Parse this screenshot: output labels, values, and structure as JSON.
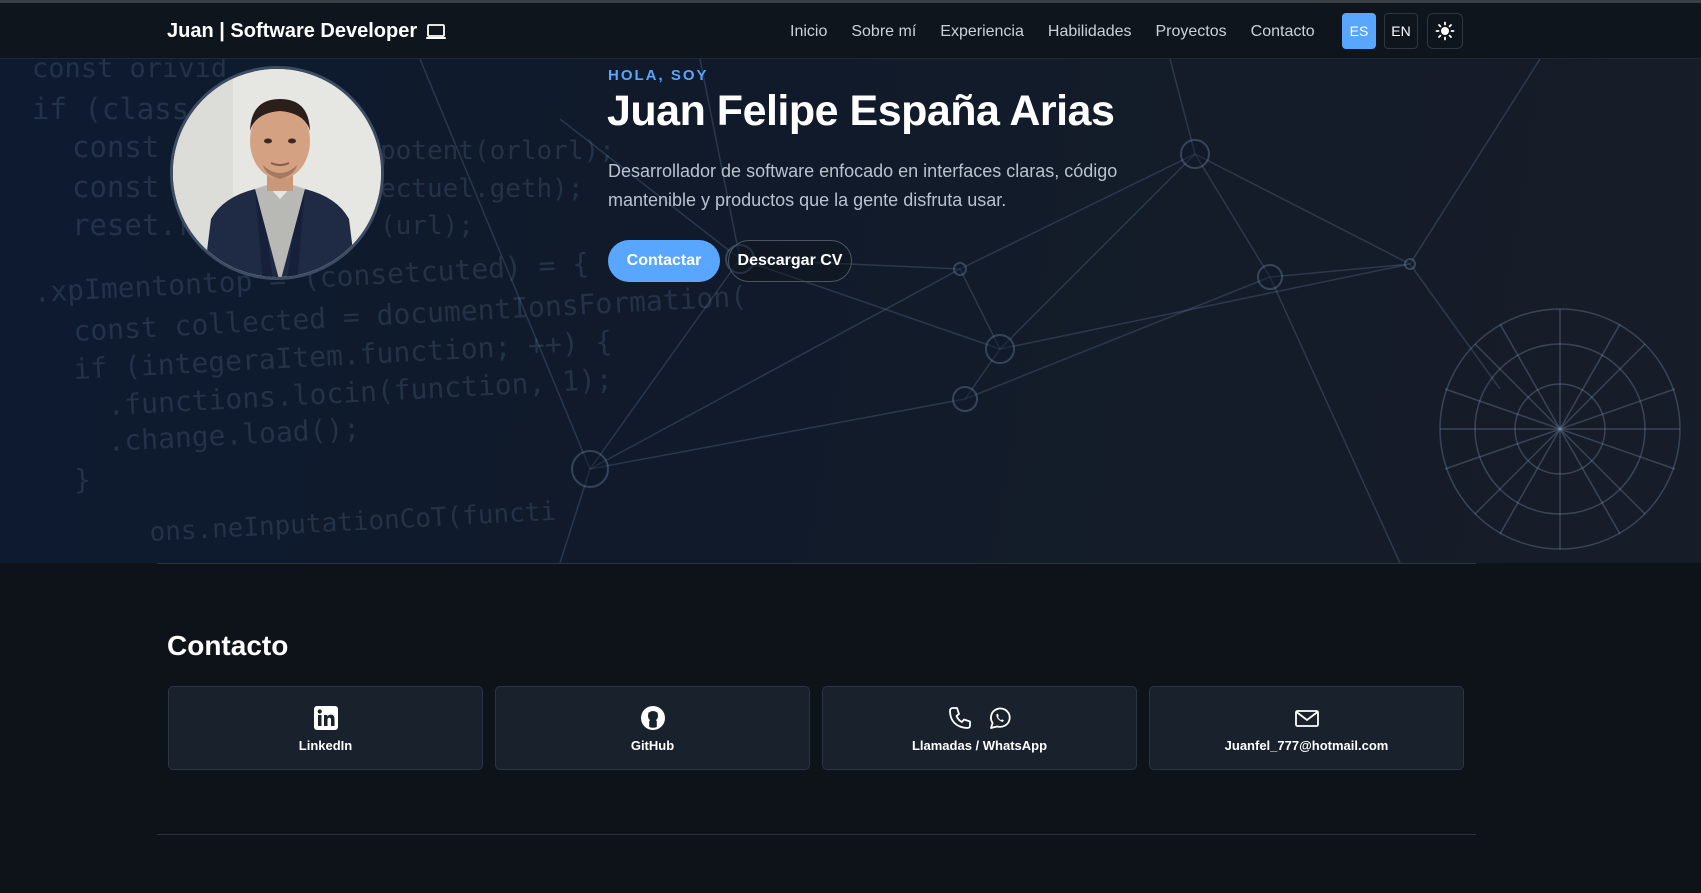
{
  "navbar": {
    "brand": "Juan | Software Developer",
    "links": [
      "Inicio",
      "Sobre mí",
      "Experiencia",
      "Habilidades",
      "Proyectos",
      "Contacto"
    ],
    "lang_es": "ES",
    "lang_en": "EN",
    "active_lang": "ES",
    "accent_color": "#58a6ff"
  },
  "hero": {
    "kicker": "HOLA, SOY",
    "name": "Juan Felipe España Arias",
    "description": "Desarrollador de software enfocado en interfaces claras, código mantenible y productos que la gente disfruta usar.",
    "primary_button": "Contactar",
    "secondary_button": "Descargar CV",
    "background_code": [
      "const orivid",
      "if (class",
      "const",
      "const",
      "reset.r",
      ".xpImentontop = (consetcuted) = {",
      "const collected = documentIonsFormation(",
      "if (integeraItem.function; ++) {",
      ".functions.locin(function, 1);",
      ".change.load();",
      "}",
      "ons.neInputationCoT(functi",
      "potent(orlorl);",
      "ectuel.geth);",
      "(url);"
    ]
  },
  "contact": {
    "title": "Contacto",
    "cards": [
      {
        "label": "LinkedIn",
        "icon": "linkedin-icon"
      },
      {
        "label": "GitHub",
        "icon": "github-icon"
      },
      {
        "label": "Llamadas / WhatsApp",
        "icon": "phone-icon"
      },
      {
        "label": "Juanfel_777@hotmail.com",
        "icon": "mail-icon"
      }
    ]
  },
  "colors": {
    "background": "#0e1319",
    "card": "#18212c",
    "accent": "#58a6ff"
  }
}
